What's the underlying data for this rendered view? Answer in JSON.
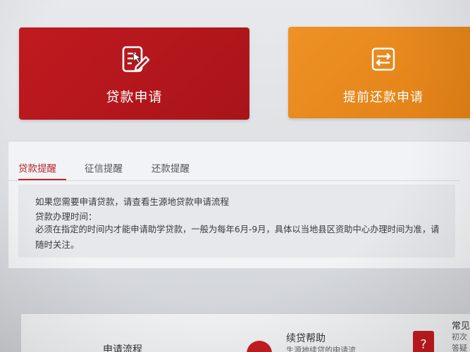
{
  "cards": {
    "loan_apply": {
      "label": "贷款申请",
      "icon": "form-edit-icon",
      "color": "#b9181e"
    },
    "early_repay": {
      "label": "提前还款申请",
      "icon": "repay-exchange-icon",
      "color": "#e8891d"
    }
  },
  "tabs": [
    {
      "label": "贷款提醒",
      "active": true
    },
    {
      "label": "征信提醒",
      "active": false
    },
    {
      "label": "还款提醒",
      "active": false
    }
  ],
  "notice": {
    "line1": "如果您需要申请贷款，请查看生源地贷款申请流程",
    "line2": "贷款办理时间：",
    "line3": "必须在指定的时间内才能申请助学贷款，一般为每年6月-9月，具体以当地县区资助中心办理时间为准，请",
    "line4": "随时关注。"
  },
  "bottom": {
    "process_title": "申请流程",
    "renew_title": "续贷帮助",
    "renew_sub": "生源地续贷的申请流",
    "faq_title": "常见",
    "faq_sub1": "初次",
    "faq_sub2": "答疑",
    "clipboard_glyph": "?"
  },
  "colors": {
    "accent_red": "#c0262c",
    "accent_orange": "#e8891d"
  }
}
